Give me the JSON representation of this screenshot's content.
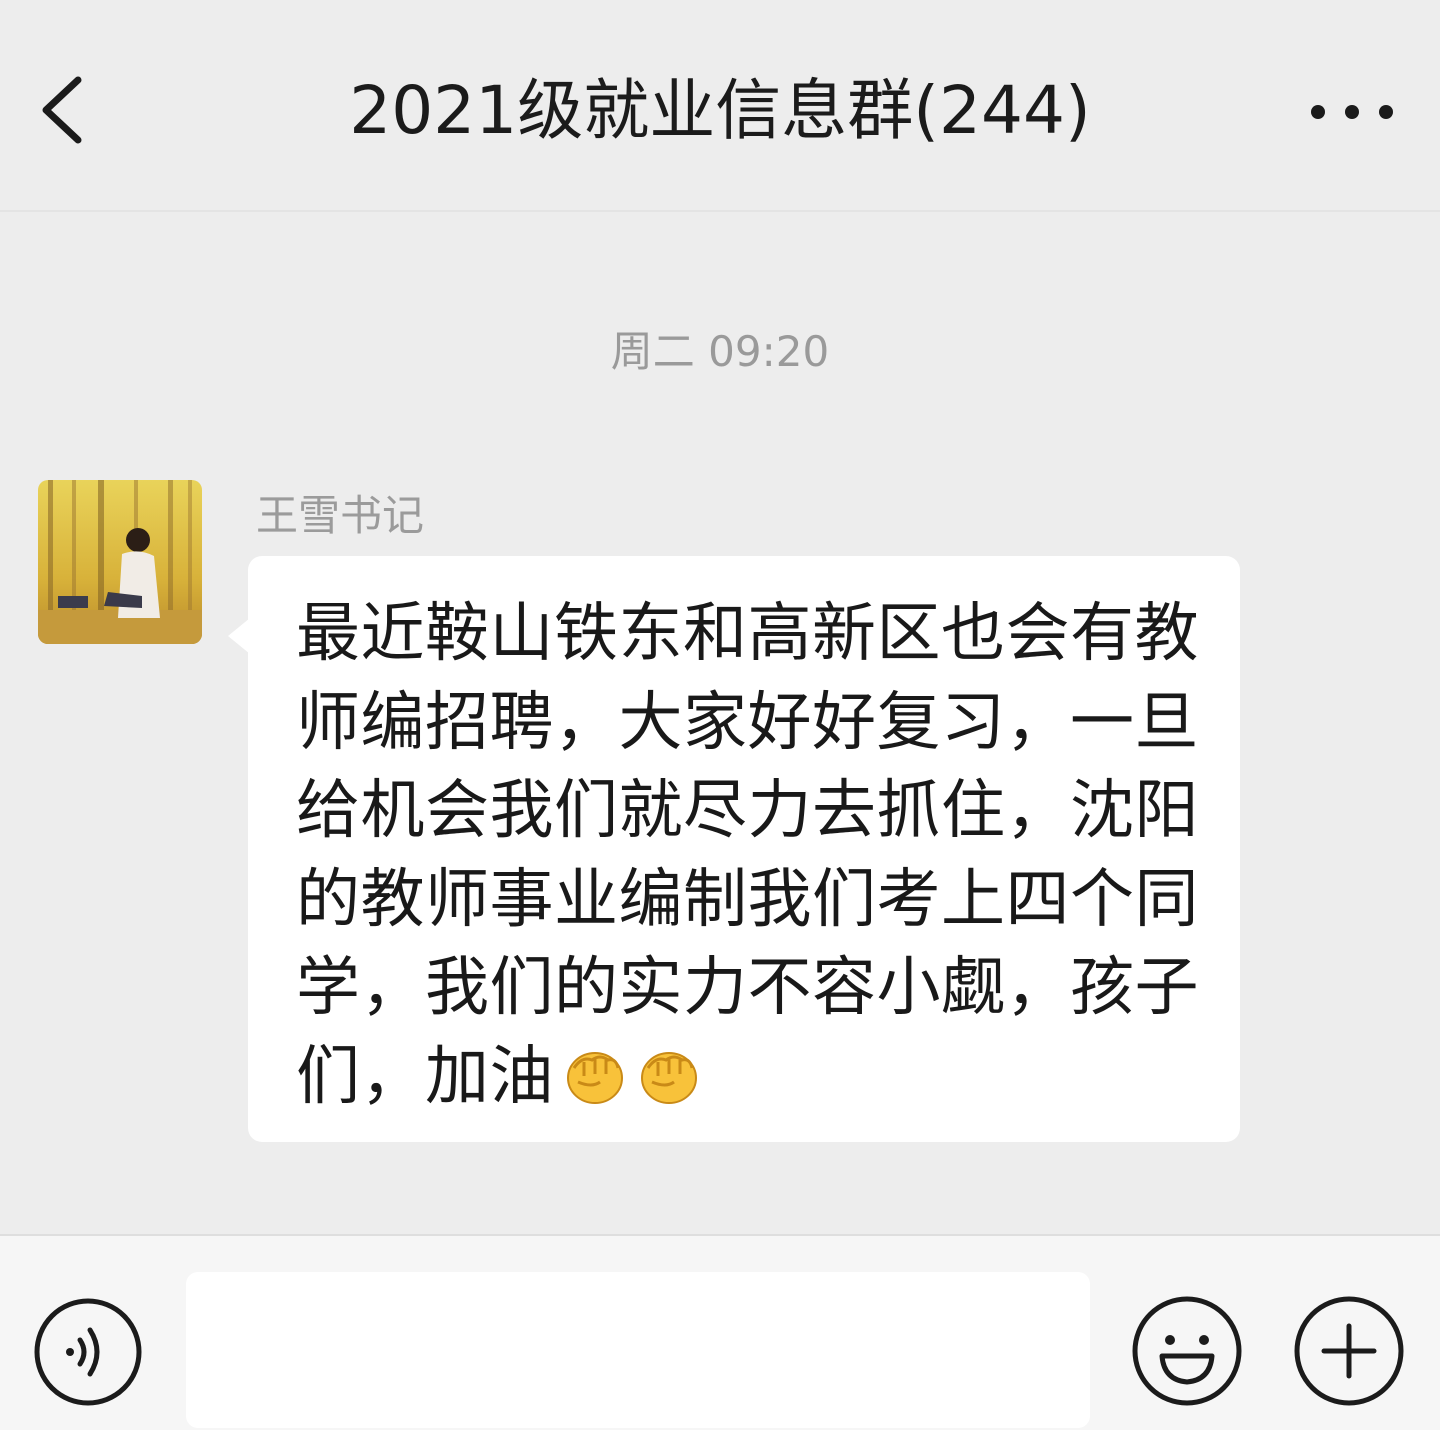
{
  "header": {
    "title": "2021级就业信息群(244)",
    "back_icon": "chevron-left-icon",
    "more_icon": "more-dots-icon"
  },
  "chat": {
    "timestamp": "周二 09:20",
    "messages": [
      {
        "sender": "王雪书记",
        "text": "最近鞍山铁东和高新区也会有教师编招聘，大家好好复习，一旦给机会我们就尽力去抓住，沈阳的教师事业编制我们考上四个同学，我们的实力不容小觑，孩子们，加油",
        "emojis": [
          "fist-emoji",
          "fist-emoji"
        ],
        "bubble_color": "#ffffff"
      }
    ]
  },
  "input_bar": {
    "voice_icon": "voice-icon",
    "input_value": "",
    "emoji_icon": "smiley-icon",
    "plus_icon": "plus-icon"
  },
  "colors": {
    "background": "#ededed",
    "bubble": "#ffffff",
    "text": "#191919",
    "meta_text": "#9b9b9b"
  }
}
